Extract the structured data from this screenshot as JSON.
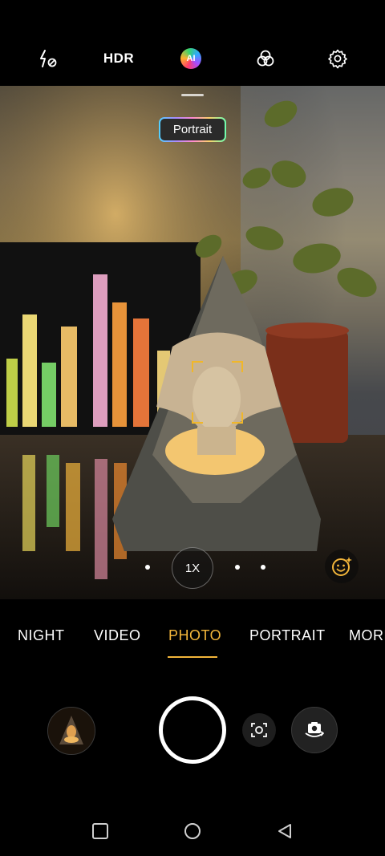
{
  "top_bar": {
    "flash_icon": "flash-off-icon",
    "hdr_label": "HDR",
    "ai_label": "AI",
    "filter_icon": "filter-icon",
    "settings_icon": "gear-icon"
  },
  "viewfinder": {
    "scene_label": "Portrait",
    "focus_color": "#f0b72a"
  },
  "zoom": {
    "level_label": "1X"
  },
  "modes": {
    "items": [
      "NIGHT",
      "VIDEO",
      "PHOTO",
      "PORTRAIT",
      "MORE"
    ],
    "active": "PHOTO",
    "accent_color": "#f2b53a"
  },
  "controls": {
    "gallery_icon": "gallery-thumbnail",
    "shutter_icon": "shutter-button",
    "lens_icon": "scan-lens-icon",
    "flip_icon": "flip-camera-icon"
  },
  "nav": {
    "recents_icon": "square-icon",
    "home_icon": "circle-icon",
    "back_icon": "triangle-back-icon"
  }
}
